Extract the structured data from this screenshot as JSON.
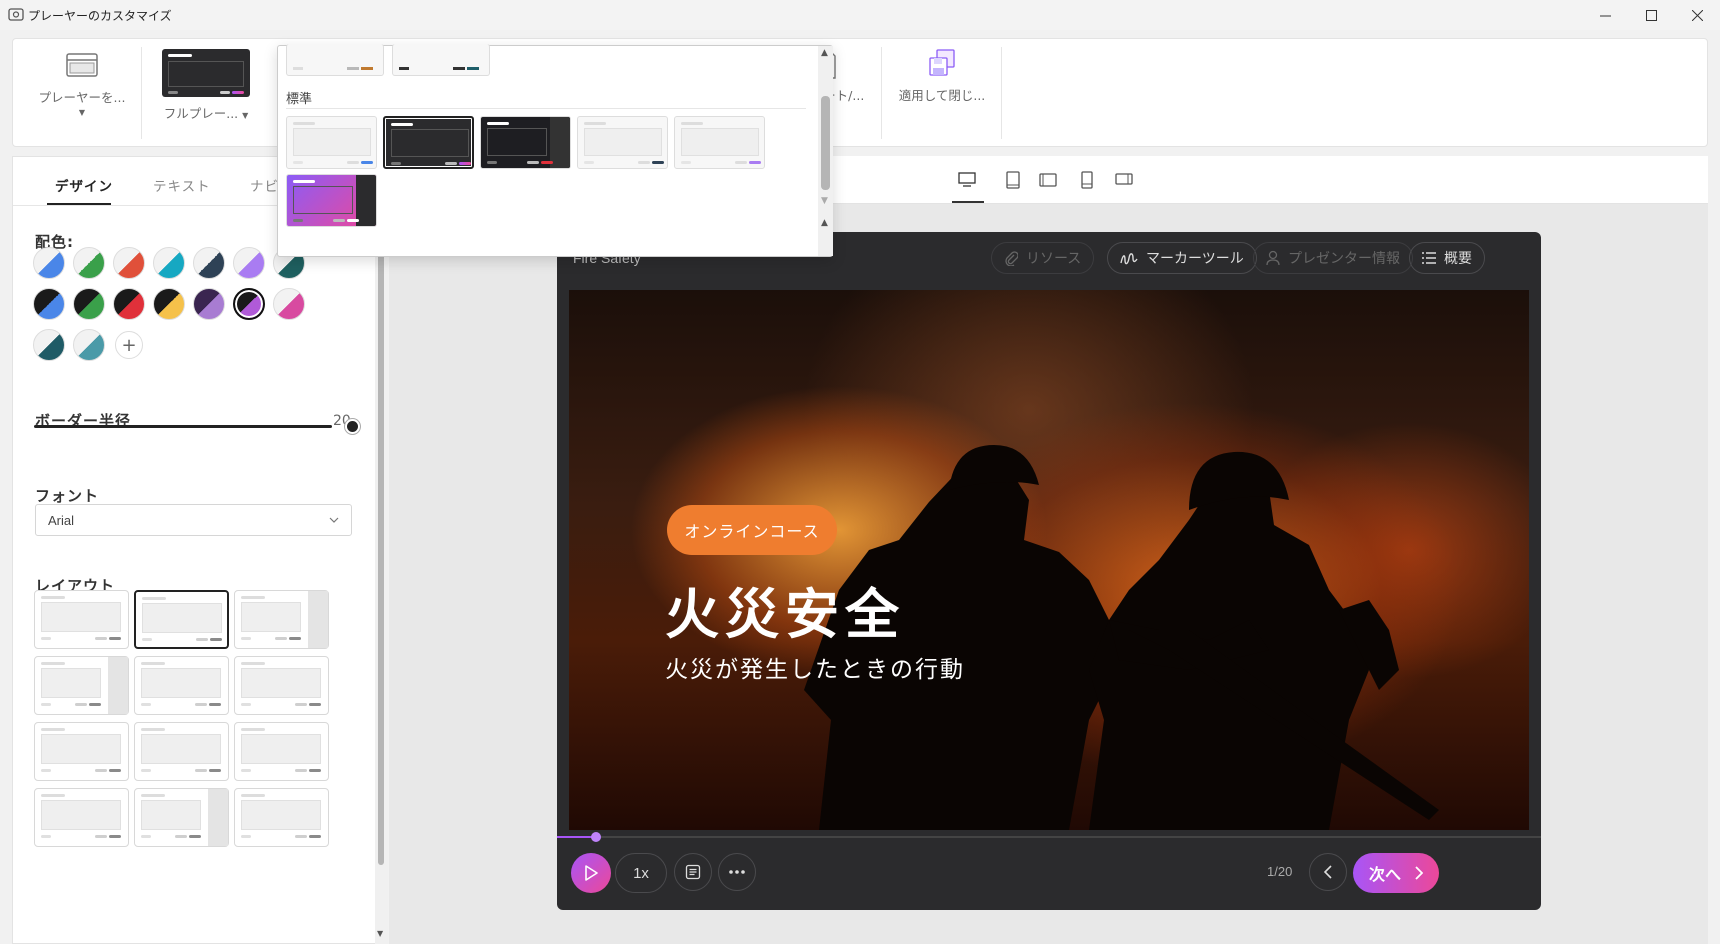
{
  "window": {
    "title": "プレーヤーのカスタマイズ"
  },
  "ribbon": {
    "player_btn": "プレーヤーを...",
    "full_player_btn": "フルプレー...",
    "import_btn": "インポート/...",
    "apply_close_btn": "適用して閉じ..."
  },
  "popup": {
    "section_label": "標準"
  },
  "left": {
    "tabs": [
      "デザイン",
      "テキスト",
      "ナビ"
    ],
    "color_label": "配色:",
    "radius_label": "ボーダー半径",
    "radius_value": "20",
    "font_label": "フォント",
    "font_value": "Arial",
    "layout_label": "レイアウト"
  },
  "player": {
    "course_title": "Fire Safety",
    "resources": "リソース",
    "marker_tool": "マーカーツール",
    "presenter_info": "プレゼンター情報",
    "summary": "概要",
    "badge": "オンラインコース",
    "headline": "火災安全",
    "subhead": "火災が発生したときの行動",
    "speed": "1x",
    "page": "1/20",
    "next": "次へ",
    "progress": 0.04
  },
  "colors": {
    "accent": "#a855f7",
    "badge": "#ef7d2f",
    "next_start": "#a855f7",
    "next_end": "#ec4899"
  }
}
